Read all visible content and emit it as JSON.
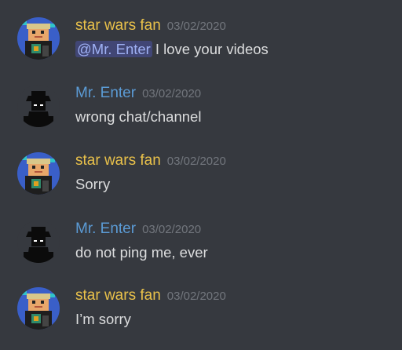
{
  "colors": {
    "background": "#36393f",
    "author_star_wars_fan": "#e9c14a",
    "author_mr_enter": "#5b9bd5",
    "timestamp": "#72767d",
    "message_text": "#dcddde",
    "mention_bg": "#414675",
    "mention_text": "#9fb1f4"
  },
  "messages": [
    {
      "author": "star wars fan",
      "timestamp": "03/02/2020",
      "avatar_icon": "pixel-character-avatar-icon",
      "mention": "@Mr. Enter",
      "text": "I love your videos"
    },
    {
      "author": "Mr. Enter",
      "timestamp": "03/02/2020",
      "avatar_icon": "shadow-figure-avatar-icon",
      "text": "wrong chat/channel"
    },
    {
      "author": "star wars fan",
      "timestamp": "03/02/2020",
      "avatar_icon": "pixel-character-avatar-icon",
      "text": "Sorry"
    },
    {
      "author": "Mr. Enter",
      "timestamp": "03/02/2020",
      "avatar_icon": "shadow-figure-avatar-icon",
      "text": "do not ping me, ever"
    },
    {
      "author": "star wars fan",
      "timestamp": "03/02/2020",
      "avatar_icon": "pixel-character-avatar-icon",
      "text": "I’m sorry"
    }
  ]
}
